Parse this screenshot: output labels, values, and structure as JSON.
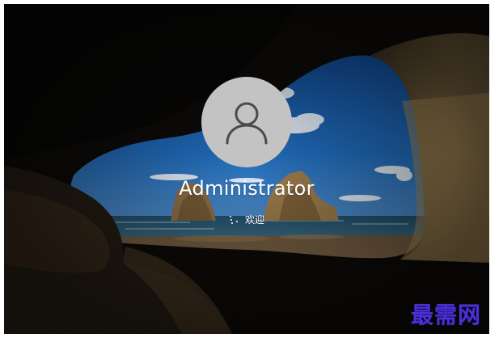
{
  "login": {
    "user_name": "Administrator",
    "status_text": "欢迎"
  },
  "avatar": {
    "icon": "user-silhouette-icon"
  },
  "spinner": {
    "icon": "loading-dots-icon"
  },
  "watermark": {
    "text": "最需网",
    "color": "#4a2fd6"
  },
  "colors": {
    "avatar_bg": "#c3c3c3",
    "avatar_icon": "#4a4a4a",
    "text": "#ffffff"
  }
}
